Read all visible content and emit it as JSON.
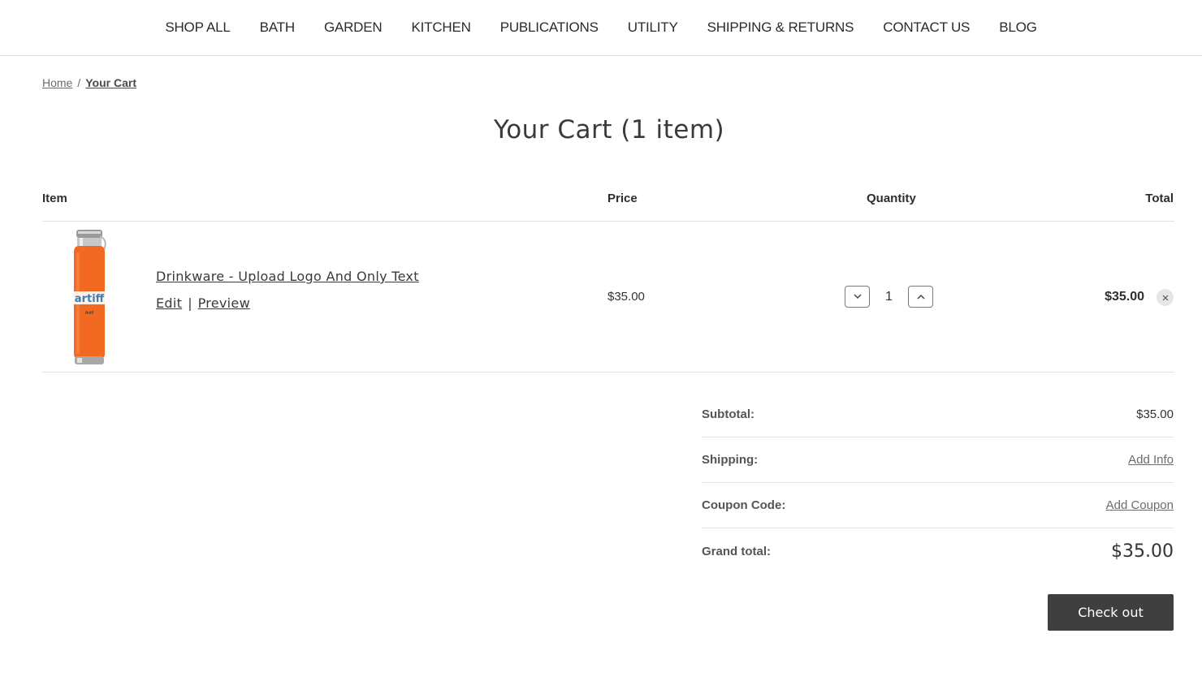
{
  "nav": {
    "items": [
      "SHOP ALL",
      "BATH",
      "GARDEN",
      "KITCHEN",
      "PUBLICATIONS",
      "UTILITY",
      "SHIPPING & RETURNS",
      "CONTACT US",
      "BLOG"
    ]
  },
  "breadcrumb": {
    "home": "Home",
    "separator": "/",
    "current": "Your Cart"
  },
  "page": {
    "title": "Your Cart (1 item)"
  },
  "table": {
    "headers": {
      "item": "Item",
      "price": "Price",
      "quantity": "Quantity",
      "total": "Total"
    }
  },
  "cart_item": {
    "name": "Drinkware - Upload Logo And Only Text",
    "edit_label": "Edit",
    "separator": "|",
    "preview_label": "Preview",
    "price": "$35.00",
    "quantity": "1",
    "total": "$35.00",
    "product_logo_text": "artiff",
    "product_subtext": "Artiff",
    "product_color": "#f26a21",
    "decrease_icon": "chevron-down-icon",
    "increase_icon": "chevron-up-icon",
    "remove_icon": "close-icon"
  },
  "totals": {
    "subtotal_label": "Subtotal:",
    "subtotal_value": "$35.00",
    "shipping_label": "Shipping:",
    "shipping_link": "Add Info",
    "coupon_label": "Coupon Code:",
    "coupon_link": "Add Coupon",
    "grand_label": "Grand total:",
    "grand_value": "$35.00"
  },
  "checkout": {
    "label": "Check out",
    "color": "#3f3f3f"
  }
}
